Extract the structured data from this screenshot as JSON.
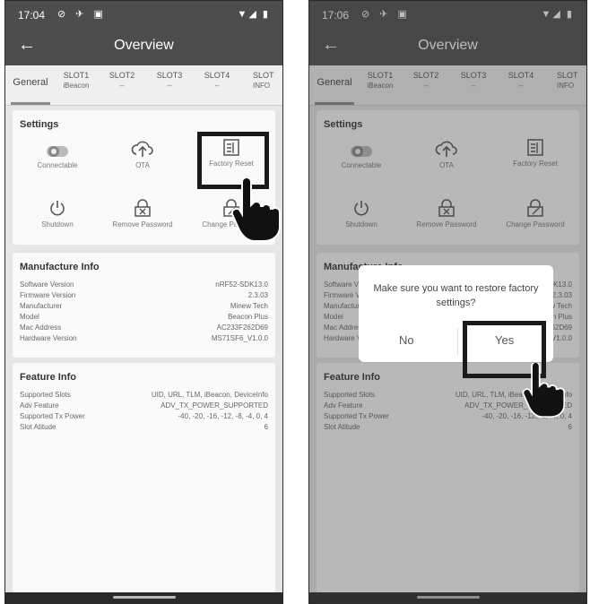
{
  "left": {
    "status": {
      "time": "17:04"
    },
    "appbar": {
      "title": "Overview"
    },
    "tabs": [
      {
        "label": "General",
        "sub": ""
      },
      {
        "label": "SLOT1",
        "sub": "iBeacon"
      },
      {
        "label": "SLOT2",
        "sub": "--"
      },
      {
        "label": "SLOT3",
        "sub": "--"
      },
      {
        "label": "SLOT4",
        "sub": "--"
      },
      {
        "label": "SLOT",
        "sub": "INFO"
      }
    ],
    "settings": {
      "header": "Settings",
      "items": [
        {
          "label": "Connectable",
          "icon": "toggle-icon"
        },
        {
          "label": "OTA",
          "icon": "cloud-upload-icon"
        },
        {
          "label": "Factory Reset",
          "icon": "factory-icon"
        },
        {
          "label": "Shutdown",
          "icon": "power-icon"
        },
        {
          "label": "Remove Password",
          "icon": "lock-remove-icon"
        },
        {
          "label": "Change Password",
          "icon": "lock-edit-icon"
        }
      ]
    },
    "manufacture": {
      "header": "Manufacture Info",
      "rows": [
        {
          "k": "Software Version",
          "v": "nRF52-SDK13.0"
        },
        {
          "k": "Firmware Version",
          "v": "2.3.03"
        },
        {
          "k": "Manufacturer",
          "v": "Minew Tech"
        },
        {
          "k": "Model",
          "v": "Beacon Plus"
        },
        {
          "k": "Mac Address",
          "v": "AC233F262D69"
        },
        {
          "k": "Hardware Version",
          "v": "MS71SF6_V1.0.0"
        }
      ]
    },
    "feature": {
      "header": "Feature Info",
      "rows": [
        {
          "k": "Supported Slots",
          "v": "UID, URL, TLM, iBeacon, DeviceInfo"
        },
        {
          "k": "Adv Feature",
          "v": "ADV_TX_POWER_SUPPORTED"
        },
        {
          "k": "Supported Tx Power",
          "v": "-40, -20, -16, -12, -8, -4, 0, 4"
        },
        {
          "k": "Slot Atitude",
          "v": "6"
        }
      ]
    }
  },
  "right": {
    "status": {
      "time": "17:06"
    },
    "dialog": {
      "message": "Make sure you want to restore factory settings?",
      "no_label": "No",
      "yes_label": "Yes"
    }
  },
  "colors": {
    "appbar": "#4d4d4d",
    "background": "#e6e6e6",
    "card": "#fafafa",
    "highlight": "#1a1a1a"
  }
}
